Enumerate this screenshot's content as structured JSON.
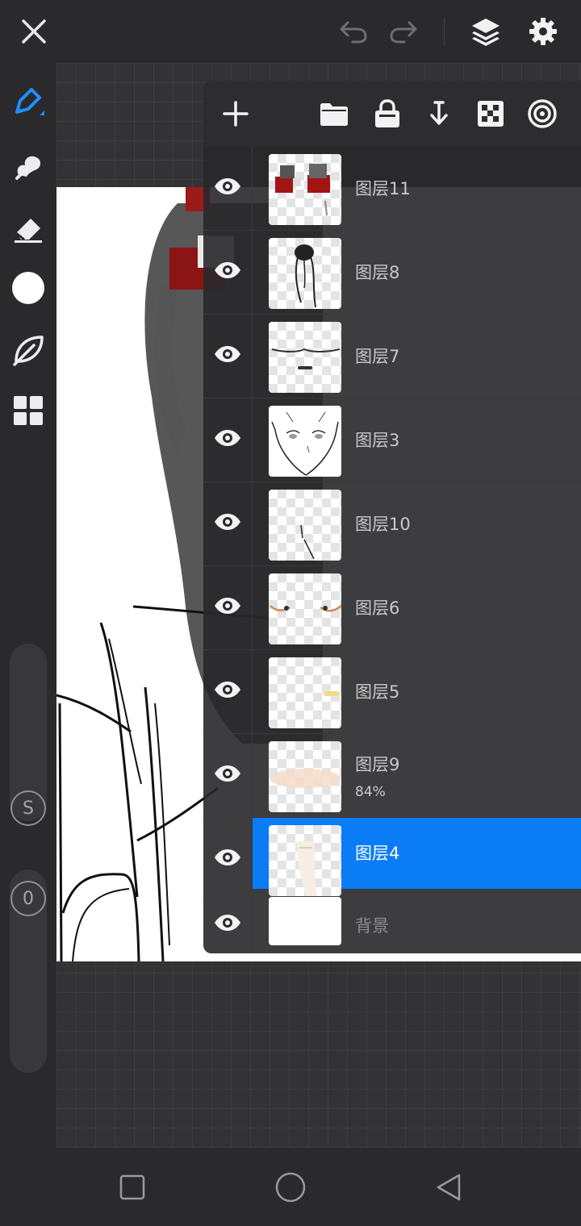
{
  "topbar": {
    "close": "close-icon",
    "undo": "undo-icon",
    "redo": "redo-icon",
    "layers": "layers-icon",
    "settings": "gear-icon"
  },
  "toolbar": {
    "tools": [
      "brush-icon",
      "smudge-icon",
      "eraser-icon",
      "color-swatch",
      "leaf-icon",
      "grid-icon"
    ],
    "brush_color": "#1e90ff",
    "current_color": "#ffffff",
    "size_slider_label": "S",
    "opacity_slider_label": "0"
  },
  "layer_panel": {
    "toolbar": [
      "add-layer-icon",
      "folder-icon",
      "lock-icon",
      "merge-down-icon",
      "transparency-icon",
      "blend-icon"
    ],
    "layers": [
      {
        "name": "图层11",
        "opacity": "",
        "visible": true,
        "selected": false
      },
      {
        "name": "图层8",
        "opacity": "",
        "visible": true,
        "selected": false
      },
      {
        "name": "图层7",
        "opacity": "",
        "visible": true,
        "selected": false
      },
      {
        "name": "图层3",
        "opacity": "",
        "visible": true,
        "selected": false
      },
      {
        "name": "图层10",
        "opacity": "",
        "visible": true,
        "selected": false
      },
      {
        "name": "图层6",
        "opacity": "",
        "visible": true,
        "selected": false
      },
      {
        "name": "图层5",
        "opacity": "",
        "visible": true,
        "selected": false
      },
      {
        "name": "图层9",
        "opacity": "84%",
        "visible": true,
        "selected": false
      },
      {
        "name": "图层4",
        "opacity": "",
        "visible": true,
        "selected": true
      },
      {
        "name": "背景",
        "opacity": "",
        "visible": true,
        "selected": false
      }
    ],
    "selected_color": "#0a7cf5"
  },
  "navbar": [
    "recents-button",
    "home-button",
    "back-button"
  ]
}
